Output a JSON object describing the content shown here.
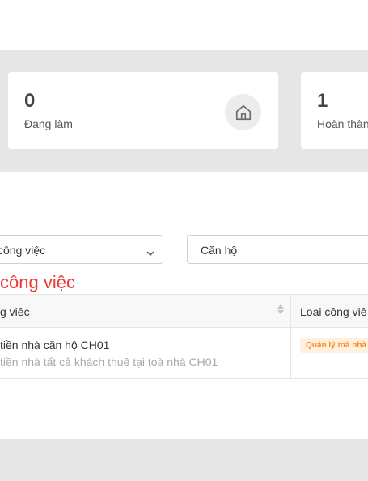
{
  "stats": [
    {
      "value": "0",
      "label": "Đang làm",
      "icon": "home-icon"
    },
    {
      "value": "1",
      "label": "Hoàn thàn"
    }
  ],
  "filters": {
    "job_select": "công việc",
    "apartment_input": "Căn hộ"
  },
  "error_text": "công việc",
  "table": {
    "columns": [
      "g việc",
      "Loại công việ"
    ],
    "rows": [
      {
        "title": "tiền nhà căn hộ CH01",
        "description": "tiền nhà tất cả khách thuê tại toà nhà CH01",
        "type_tag": "Quản lý toà nhà"
      }
    ]
  },
  "colors": {
    "error": "#ee3636",
    "tag_text": "#ff8a1e",
    "tag_bg": "#fff0e0"
  }
}
